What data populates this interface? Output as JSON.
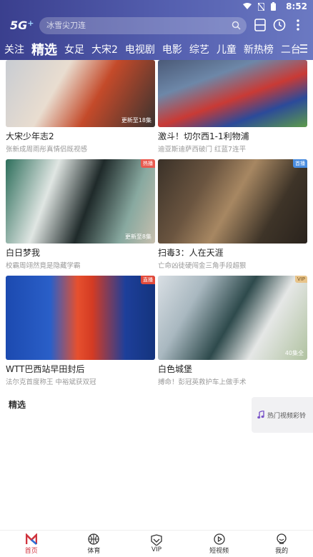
{
  "status": {
    "time": "8:52"
  },
  "header": {
    "logo": "5G",
    "search_placeholder": "冰雪尖刀连",
    "tabs": [
      "关注",
      "精选",
      "女足",
      "大宋2",
      "电视剧",
      "电影",
      "综艺",
      "儿童",
      "新热榜",
      "二台"
    ],
    "active_tab": "精选"
  },
  "cards": [
    {
      "title": "大宋少年志2",
      "subtitle": "张新成周雨彤真情侣既视感",
      "badge": "",
      "episode": "更新至18集"
    },
    {
      "title": "激斗！切尔西1-1利物浦",
      "subtitle": "迪亚斯迪萨西破门 红蓝7连平",
      "badge": "",
      "episode": ""
    },
    {
      "title": "白日梦我",
      "subtitle": "校霸周翊然竟是隐藏学霸",
      "badge": "热播",
      "episode": "更新至8集"
    },
    {
      "title": "扫毒3：人在天涯",
      "subtitle": "亡命凶徒硬闯金三角手段超狠",
      "badge": "首播",
      "episode": ""
    },
    {
      "title": "WTT巴西站早田封后",
      "subtitle": "法尔克首度称王 中裕斌获双冠",
      "badge": "直播",
      "episode": ""
    },
    {
      "title": "白色城堡",
      "subtitle": "搏命！彭冠英救护车上做手术",
      "badge": "VIP",
      "episode": "40集全"
    }
  ],
  "section": {
    "title": "精选"
  },
  "float_button": {
    "label": "热门视频彩铃"
  },
  "bottom_nav": [
    {
      "label": "首页",
      "icon": "home-icon"
    },
    {
      "label": "体育",
      "icon": "basketball-icon"
    },
    {
      "label": "VIP",
      "icon": "vip-icon"
    },
    {
      "label": "短视频",
      "icon": "play-circle-icon"
    },
    {
      "label": "我的",
      "icon": "profile-icon"
    }
  ],
  "colors": {
    "header_start": "#3a3f8e",
    "header_end": "#6b79c2",
    "accent": "#d0343e"
  }
}
